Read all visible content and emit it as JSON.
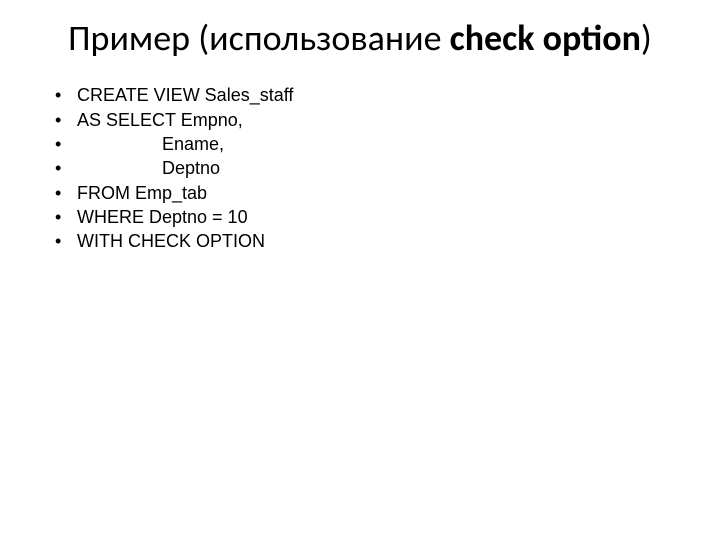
{
  "title_plain": "Пример (использование ",
  "title_bold": "check option",
  "title_close": ")",
  "bullets": [
    "CREATE VIEW Sales_staff",
    "AS SELECT Empno,",
    "                 Ename,",
    "                 Deptno",
    "FROM Emp_tab",
    "WHERE Deptno = 10",
    "WITH CHECK OPTION"
  ]
}
